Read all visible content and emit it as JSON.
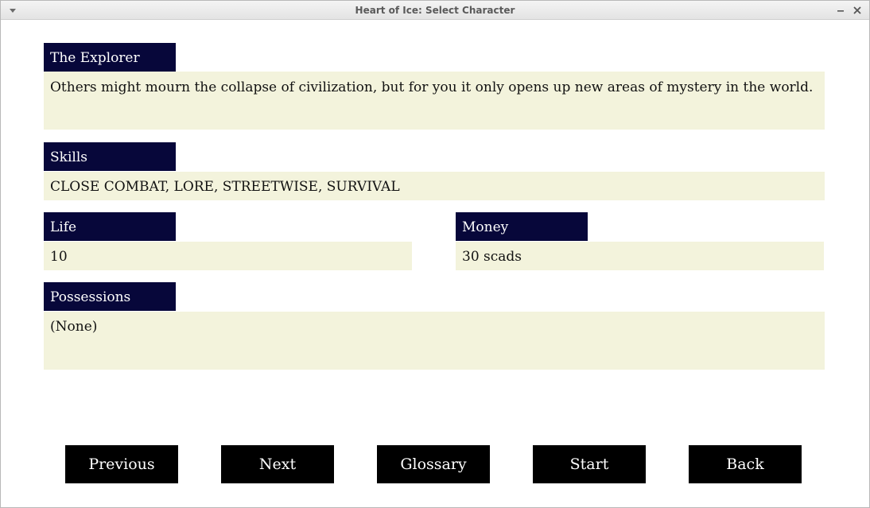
{
  "window": {
    "title": "Heart of Ice: Select Character",
    "menu_icon": "chevron-down-icon",
    "minimize_icon": "minimize-icon",
    "close_icon": "close-icon"
  },
  "character": {
    "name": "The Explorer",
    "description": "Others might mourn the collapse of civilization, but for you it only opens up new areas of mystery in the world."
  },
  "skills": {
    "label": "Skills",
    "value": "CLOSE COMBAT, LORE, STREETWISE, SURVIVAL"
  },
  "life": {
    "label": "Life",
    "value": "10"
  },
  "money": {
    "label": "Money",
    "value": "30 scads"
  },
  "possessions": {
    "label": "Possessions",
    "value": "(None)"
  },
  "buttons": {
    "previous": "Previous",
    "next": "Next",
    "glossary": "Glossary",
    "start": "Start",
    "back": "Back"
  },
  "colors": {
    "label_bg": "#07073a",
    "field_bg": "#f3f3dc",
    "button_bg": "#000000"
  }
}
